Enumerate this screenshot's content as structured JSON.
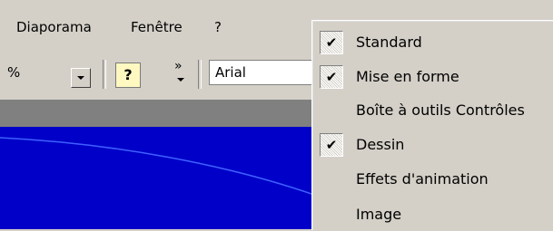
{
  "menubar": {
    "items": [
      {
        "label": "Diaporama"
      },
      {
        "label": "Fenêtre"
      },
      {
        "label": "?"
      }
    ]
  },
  "toolbar": {
    "zoom_value": "%",
    "help_icon": "question-help-icon",
    "more_icon": "chevron-double-right-icon",
    "font_name": "Arial"
  },
  "menu": {
    "items": [
      {
        "label": "Standard",
        "checked": true
      },
      {
        "label": "Mise en forme",
        "checked": true
      },
      {
        "label": "Boîte à outils Contrôles",
        "checked": false
      },
      {
        "label": "Dessin",
        "checked": true
      },
      {
        "label": "Effets d'animation",
        "checked": false
      },
      {
        "label": "Image",
        "checked": false
      }
    ]
  },
  "colors": {
    "window_face": "#d4d0c8",
    "slide_background": "#0000c8",
    "gray_band": "#808080"
  }
}
